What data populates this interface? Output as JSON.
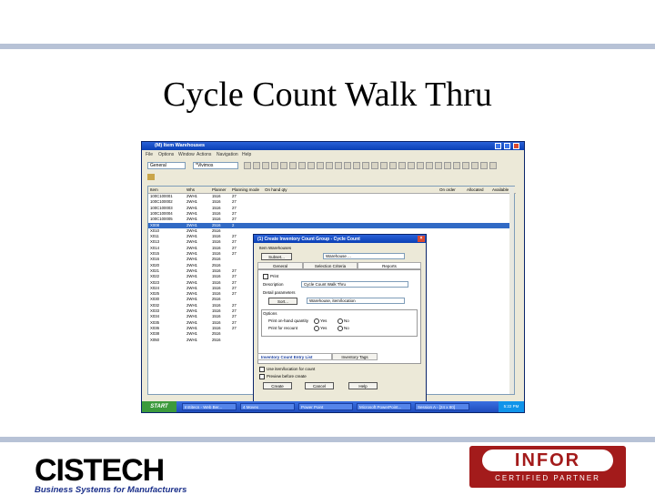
{
  "slide": {
    "title": "Cycle Count Walk Thru"
  },
  "window": {
    "title": "(M) Item Warehouses",
    "menu": [
      "File",
      "Options",
      "Window",
      "Actions",
      "Navigation",
      "Help"
    ],
    "toolbar": {
      "combo1": "General",
      "combo2": "*Vivimos"
    },
    "list_columns": [
      "Item",
      "Whs",
      "Planner",
      "Planning mode",
      "On hand qty",
      "On order",
      "Allocated",
      "Available"
    ],
    "rows": [
      [
        "100C100001",
        "2WH1",
        "1516",
        "27"
      ],
      [
        "100C100002",
        "2WH1",
        "1516",
        "27"
      ],
      [
        "100C100003",
        "2WH1",
        "1516",
        "27"
      ],
      [
        "100C100004",
        "2WH1",
        "1516",
        "27"
      ],
      [
        "100C100005",
        "2WH1",
        "1516",
        "27"
      ],
      [
        "X008",
        "2WH1",
        "2516",
        "2"
      ],
      [
        "X010",
        "2WH1",
        "2516",
        ""
      ],
      [
        "X011",
        "2WH1",
        "1516",
        "27"
      ],
      [
        "X013",
        "2WH1",
        "1516",
        "27"
      ],
      [
        "X014",
        "2WH1",
        "1516",
        "27"
      ],
      [
        "X015",
        "2WH1",
        "1516",
        "27"
      ],
      [
        "X016",
        "2WH1",
        "2516",
        ""
      ],
      [
        "X020",
        "2WH1",
        "2516",
        ""
      ],
      [
        "X021",
        "2WH1",
        "1516",
        "27"
      ],
      [
        "X022",
        "2WH1",
        "1516",
        "27"
      ],
      [
        "X023",
        "2WH1",
        "1516",
        "27"
      ],
      [
        "X024",
        "2WH1",
        "1516",
        "27"
      ],
      [
        "X025",
        "2WH1",
        "1516",
        "27"
      ],
      [
        "X030",
        "2WH1",
        "2516",
        ""
      ],
      [
        "X032",
        "2WH1",
        "1516",
        "27"
      ],
      [
        "X033",
        "2WH1",
        "1516",
        "27"
      ],
      [
        "X034",
        "2WH1",
        "1516",
        "27"
      ],
      [
        "X035",
        "2WH1",
        "1516",
        "27"
      ],
      [
        "X036",
        "2WH1",
        "1516",
        "27"
      ],
      [
        "X038",
        "2WH1",
        "2516",
        ""
      ],
      [
        "X050",
        "2WH1",
        "2516",
        ""
      ]
    ],
    "selected_row": 5
  },
  "dialog": {
    "title": "(1) Create Inventory Count Group - Cycle Count",
    "subset_label": "Item Warehouses",
    "subset_button": "Subset...",
    "subset_value": "Warehouse ...",
    "tabs": [
      "General",
      "Selection Criteria",
      "Reports"
    ],
    "active_tab": 2,
    "print_label": "Print",
    "description_label": "Description",
    "description_value": "Cycle Count Walk Thru",
    "detail_label": "Detail parameters",
    "sort_button": "Sort...",
    "sort_value": "Warehouse, item/location",
    "options_label": "Options",
    "opt1_label": "Print on-hand quantity",
    "opt2_label": "Print for recount",
    "yes": "Yes",
    "no": "No",
    "report1": "Inventory Count Entry List",
    "report2": "Inventory Tags",
    "check_use_item": "Use item/location for count",
    "check_preview": "Preview before create",
    "btn_create": "Create",
    "btn_cancel": "Cancel",
    "btn_help": "Help"
  },
  "taskbar": {
    "start": "START",
    "tasks": [
      "InSitecn - Web Ber...",
      "4 Movex",
      "Power Point",
      "Microsoft PowerPoint...",
      "Session A - [24 x 80]"
    ],
    "clock": "5:22 PM"
  },
  "logos": {
    "cistech": "CISTECH",
    "cistech_tagline": "Business Systems for Manufacturers",
    "infor": "INFOR",
    "infor_tagline": "CERTIFIED PARTNER"
  }
}
